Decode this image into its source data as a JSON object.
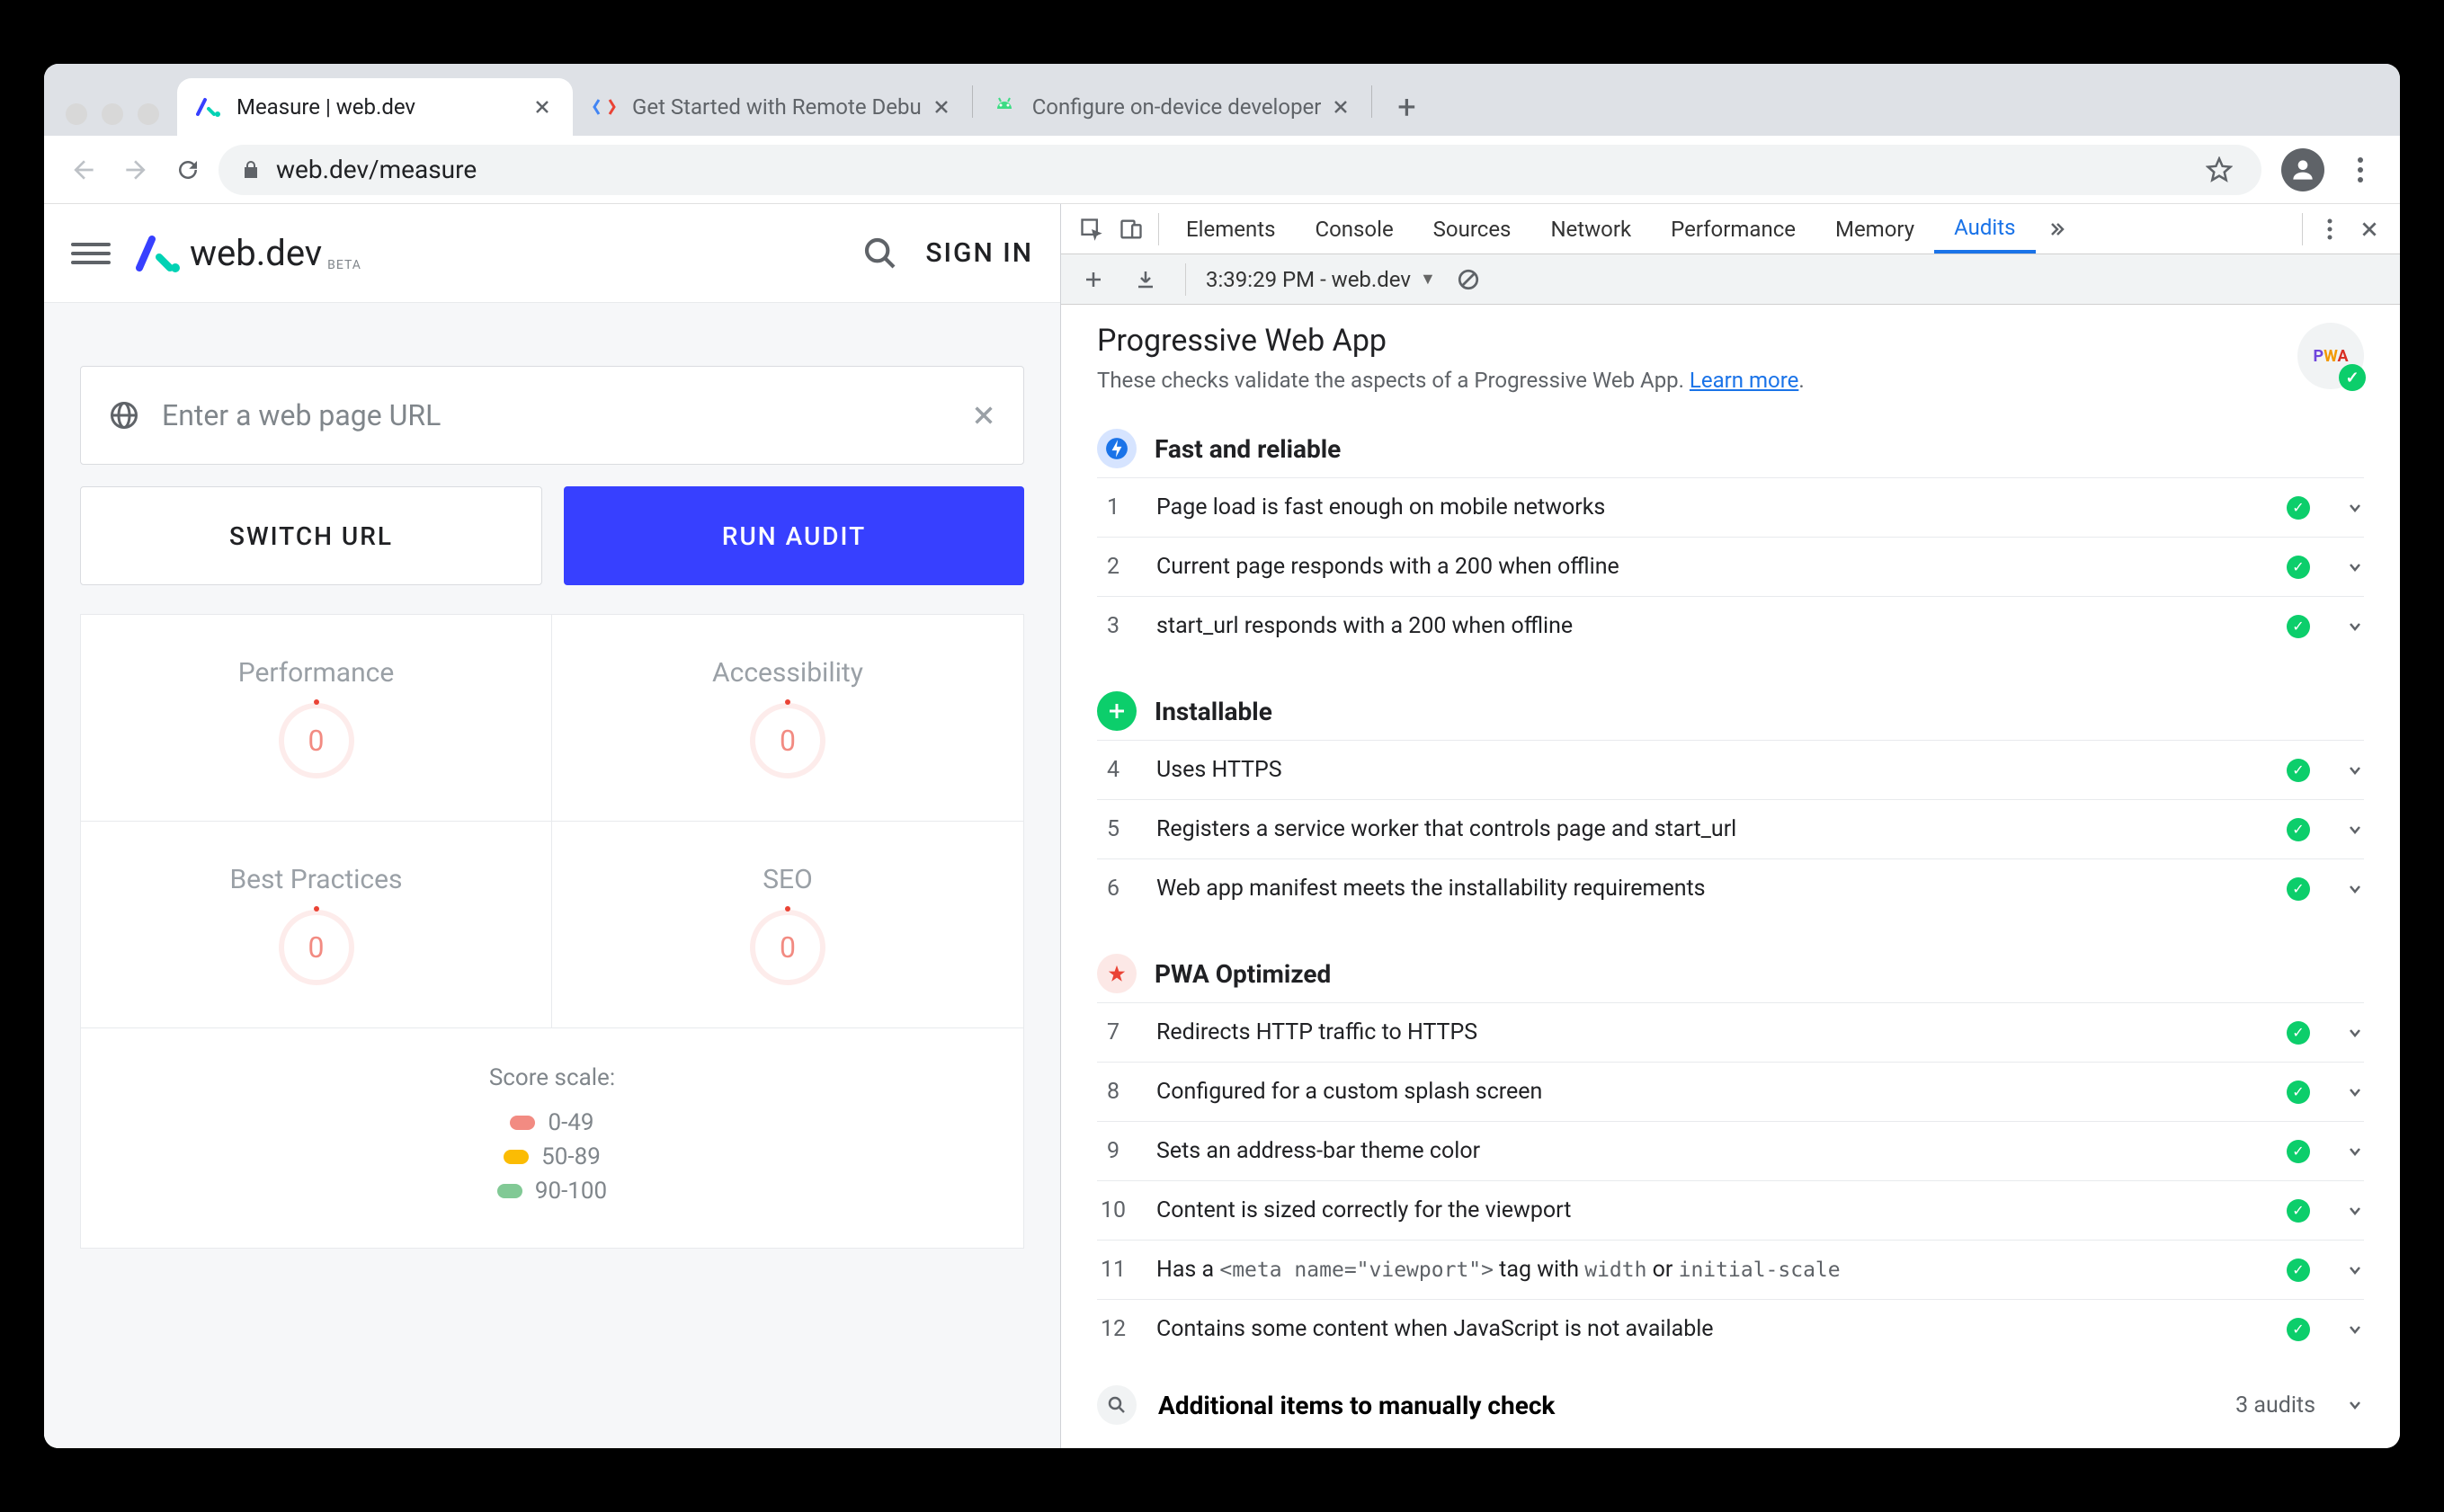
{
  "tabs": [
    {
      "title": "Measure  |  web.dev"
    },
    {
      "title": "Get Started with Remote Debu"
    },
    {
      "title": "Configure on-device developer"
    }
  ],
  "omnibox": {
    "url": "web.dev/measure"
  },
  "site": {
    "logo_text": "web.dev",
    "logo_beta": "BETA",
    "sign_in": "SIGN IN",
    "url_placeholder": "Enter a web page URL",
    "switch_url": "SWITCH URL",
    "run_audit": "RUN AUDIT",
    "metrics": [
      {
        "label": "Performance",
        "value": "0"
      },
      {
        "label": "Accessibility",
        "value": "0"
      },
      {
        "label": "Best Practices",
        "value": "0"
      },
      {
        "label": "SEO",
        "value": "0"
      }
    ],
    "score_scale_title": "Score scale:",
    "score_scale": [
      {
        "range": "0-49",
        "class": "pill-red"
      },
      {
        "range": "50-89",
        "class": "pill-orange"
      },
      {
        "range": "90-100",
        "class": "pill-green"
      }
    ]
  },
  "devtools": {
    "tabs": [
      "Elements",
      "Console",
      "Sources",
      "Network",
      "Performance",
      "Memory",
      "Audits"
    ],
    "active_tab": "Audits",
    "subbar": {
      "session": "3:39:29 PM - web.dev"
    },
    "audit": {
      "title": "Progressive Web App",
      "desc_pre": "These checks validate the aspects of a Progressive Web App. ",
      "desc_link": "Learn more",
      "desc_post": ".",
      "sections": [
        {
          "icon": "fast",
          "title": "Fast and reliable",
          "items": [
            {
              "n": "1",
              "t": "Page load is fast enough on mobile networks"
            },
            {
              "n": "2",
              "t": "Current page responds with a 200 when offline"
            },
            {
              "n": "3",
              "t": "start_url responds with a 200 when offline"
            }
          ]
        },
        {
          "icon": "install",
          "title": "Installable",
          "items": [
            {
              "n": "4",
              "t": "Uses HTTPS"
            },
            {
              "n": "5",
              "t": "Registers a service worker that controls page and start_url"
            },
            {
              "n": "6",
              "t": "Web app manifest meets the installability requirements"
            }
          ]
        },
        {
          "icon": "opt",
          "title": "PWA Optimized",
          "items": [
            {
              "n": "7",
              "t": "Redirects HTTP traffic to HTTPS"
            },
            {
              "n": "8",
              "t": "Configured for a custom splash screen"
            },
            {
              "n": "9",
              "t": "Sets an address-bar theme color"
            },
            {
              "n": "10",
              "t": "Content is sized correctly for the viewport"
            },
            {
              "n": "11",
              "html": "Has a <code>&lt;meta name=\"viewport\"&gt;</code> tag with <code>width</code> or <code>initial-scale</code>"
            },
            {
              "n": "12",
              "t": "Contains some content when JavaScript is not available"
            }
          ]
        }
      ],
      "manual": {
        "title": "Additional items to manually check",
        "count": "3 audits"
      }
    }
  }
}
